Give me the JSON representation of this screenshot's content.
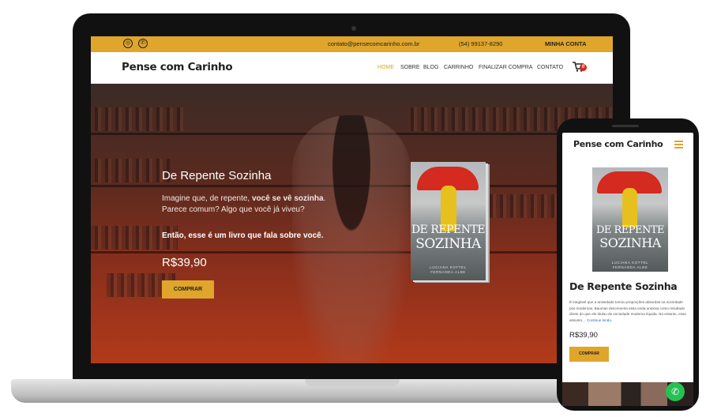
{
  "topbar": {
    "email": "contato@pensecomcarinho.com.br",
    "phone": "(54) 99137-8290",
    "account": "MINHA CONTA",
    "social_icons": [
      "instagram-icon",
      "whatsapp-icon"
    ]
  },
  "nav": {
    "logo": "Pense com Carinho",
    "items": [
      "HOME",
      "SOBRE",
      "BLOG",
      "CARRINHO",
      "FINALIZAR COMPRA",
      "CONTATO"
    ],
    "active": "HOME",
    "cart_count": "0"
  },
  "hero": {
    "title": "De Repente Sozinha",
    "line1_plain": "Imagine que, de repente, ",
    "line1_bold": "você se vê sozinha",
    "line1_end": ".",
    "line2": "Parece comum? Algo que você já viveu?",
    "line3": "Então, esse é um livro que fala sobre você.",
    "price": "R$39,90",
    "button": "COMPRAR"
  },
  "book_cover": {
    "title_line1": "DE REPENTE",
    "title_line2": "SOZINHA",
    "author_line1": "LUCIANA KOTTEL",
    "author_line2": "FERNANDA ALBE"
  },
  "mobile": {
    "logo": "Pense com Carinho",
    "title": "De Repente Sozinha",
    "description": "É inegável que a ansiedade tomou proporções absurdas na sociedade pós modernas. Bauman descreveria essa onda ansiosa como resultado direto do que ele titulou de sociedade moderna líquida. No entanto, esse assunto… ",
    "more_link": "Continue lendo.",
    "price": "R$39,90",
    "button": "COMPRAR"
  },
  "colors": {
    "accent": "#e0a52b",
    "hero_bottom": "#b23a1a",
    "cart_badge": "#d9261c",
    "whatsapp": "#25c152"
  }
}
